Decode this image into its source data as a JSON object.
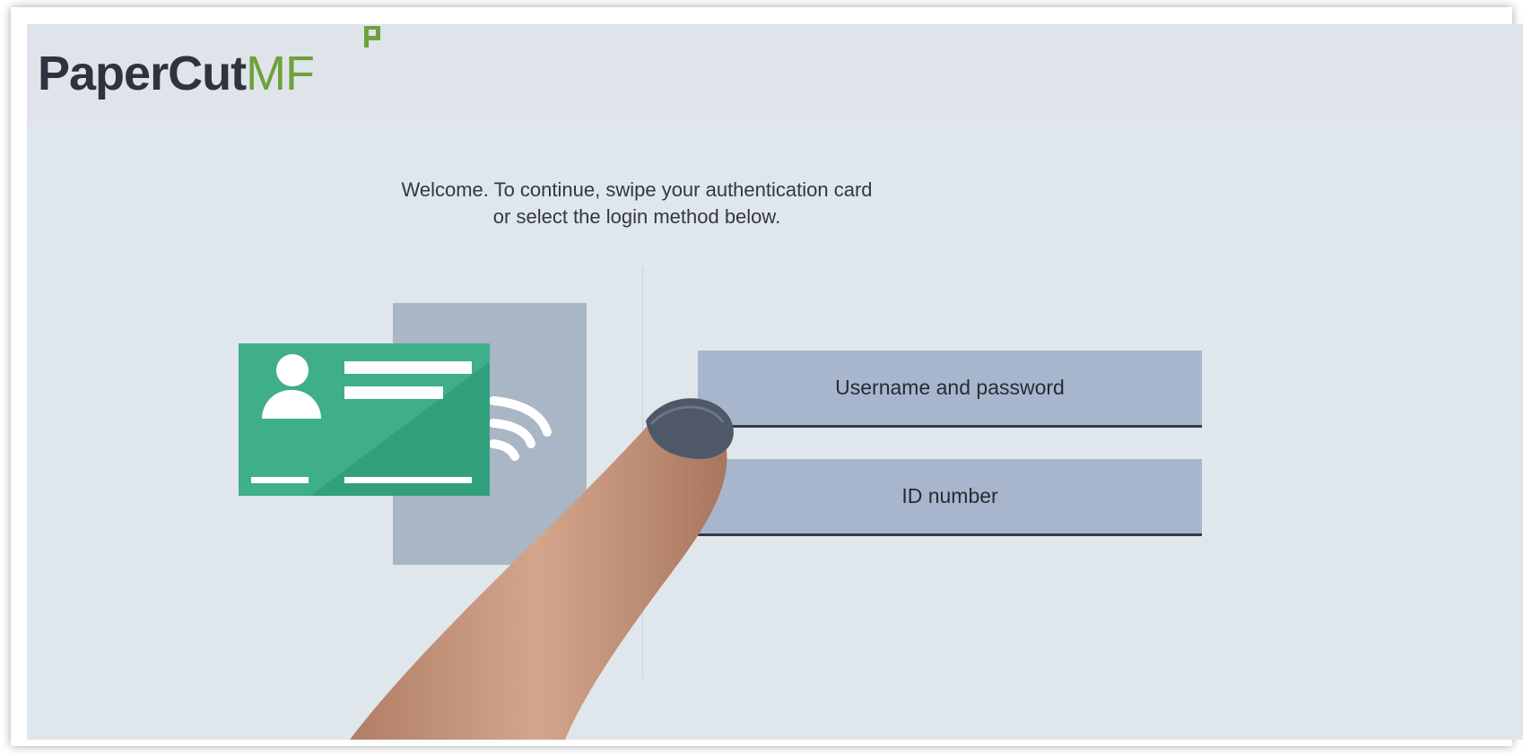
{
  "logo": {
    "main": "PaperCut",
    "sub": "MF"
  },
  "welcome": {
    "line1": "Welcome. To continue, swipe your authentication card",
    "line2": "or select the login method below."
  },
  "login_methods": [
    {
      "label": "Username and password"
    },
    {
      "label": "ID number"
    }
  ],
  "icons": {
    "card": "id-card-icon",
    "contactless": "contactless-wave-icon",
    "logo_flag": "papercut-flag-icon"
  },
  "colors": {
    "brand_dark": "#2e3340",
    "brand_green": "#6ea13c",
    "card_green": "#3fae8a",
    "button_bg": "#a7b6cd",
    "screen_bg": "#dfe6ec"
  }
}
